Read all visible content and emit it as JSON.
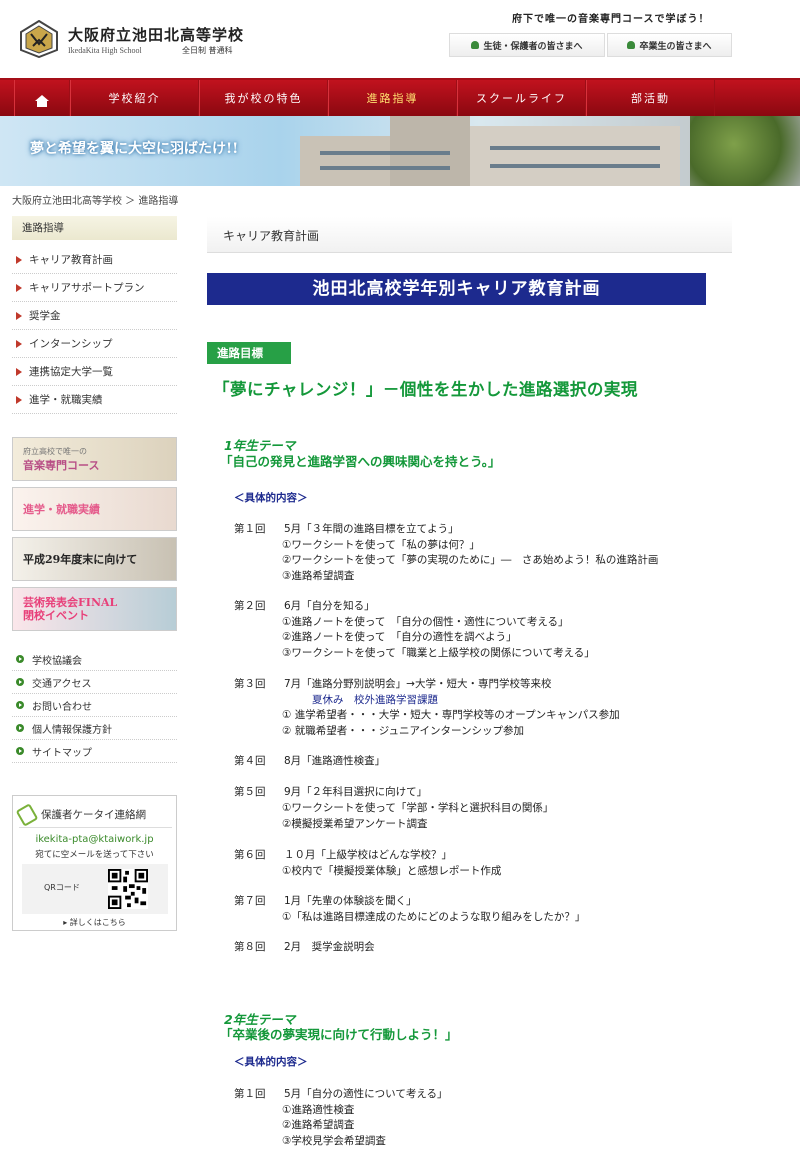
{
  "header": {
    "school_name": "大阪府立池田北高等学校",
    "school_en": "IkedaKita High School",
    "school_course": "全日制 普通科",
    "tagline": "府下で唯一の音楽専門コースで学ぼう！",
    "students_btn": "生徒・保護者の皆さまへ",
    "graduates_btn": "卒業生の皆さまへ"
  },
  "nav": {
    "items": [
      "学校紹介",
      "我が校の特色",
      "進路指導",
      "スクールライフ",
      "部活動"
    ],
    "active": "進路指導"
  },
  "banner": {
    "text": "夢と希望を翼に大空に羽ばたけ!!"
  },
  "breadcrumb": "大阪府立池田北高等学校 ＞ 進路指導",
  "sidebar": {
    "heading": "進路指導",
    "items": [
      "キャリア教育計画",
      "キャリアサポートプラン",
      "奨学金",
      "インターンシップ",
      "連携協定大学一覧",
      "進学・就職実績"
    ],
    "banners": {
      "music_small": "府立高校で唯一の",
      "music_large": "音楽専門コース",
      "results": "進学・就職実績",
      "year_end": "平成29年度末に向けて",
      "event_1": "芸術発表会FINAL",
      "event_2": "閉校イベント"
    },
    "links": [
      "学校協議会",
      "交通アクセス",
      "お問い合わせ",
      "個人情報保護方針",
      "サイトマップ"
    ],
    "pta": {
      "title": "保護者ケータイ連絡網",
      "email": "ikekita-pta@ktaiwork.jp",
      "note": "宛てに空メールを送って下さい",
      "qr_label": "QRコード",
      "more": "▸ 詳しくはこちら"
    }
  },
  "main": {
    "page_heading": "キャリア教育計画",
    "title": "池田北高校学年別キャリア教育計画",
    "goal_badge": "進路目標",
    "goal_text": "「夢にチャレンジ！」－個性を生かした進路選択の実現",
    "content_label": "＜具体的内容＞",
    "year1": {
      "label": "1年生テーマ",
      "theme": "「自己の発見と進路学習への興味関心を持とう。」",
      "sessions": [
        {
          "num": "第１回",
          "title": "5月「３年間の進路目標を立てよう」",
          "details": [
            "①ワークシートを使って「私の夢は何？」",
            "②ワークシートを使って「夢の実現のために」―　さあ始めよう！私の進路計画",
            "③進路希望調査"
          ]
        },
        {
          "num": "第２回",
          "title": "6月「自分を知る」",
          "details": [
            "①進路ノートを使って　「自分の個性・適性について考える」",
            "②進路ノートを使って　「自分の適性を調べよう」",
            "③ワークシートを使って「職業と上級学校の関係について考える」"
          ]
        },
        {
          "num": "第３回",
          "title": "7月「進路分野別説明会」→大学・短大・専門学校等来校",
          "summer": "夏休み　校外進路学習課題",
          "details": [
            "① 進学希望者・・・大学・短大・専門学校等のオープンキャンパス参加",
            "② 就職希望者・・・ジュニアインターンシップ参加"
          ]
        },
        {
          "num": "第４回",
          "title": "8月「進路適性検査」",
          "details": []
        },
        {
          "num": "第５回",
          "title": "9月「２年科目選択に向けて」",
          "details": [
            "①ワークシートを使って「学部・学科と選択科目の関係」",
            "②模擬授業希望アンケート調査"
          ]
        },
        {
          "num": "第６回",
          "title": "１０月「上級学校はどんな学校？」",
          "details": [
            "①校内で「模擬授業体験」と感想レポート作成"
          ]
        },
        {
          "num": "第７回",
          "title": "1月「先輩の体験談を聞く」",
          "details": [
            "①「私は進路目標達成のためにどのような取り組みをしたか？」"
          ]
        },
        {
          "num": "第８回",
          "title": "2月　奨学金説明会",
          "details": []
        }
      ]
    },
    "year2": {
      "label": "2年生テーマ",
      "theme": "「卒業後の夢実現に向けて行動しよう！」",
      "sessions": [
        {
          "num": "第１回",
          "title": "5月「自分の適性について考える」",
          "details": [
            "①進路適性検査",
            "②進路希望調査",
            "③学校見学会希望調査"
          ]
        }
      ]
    }
  }
}
